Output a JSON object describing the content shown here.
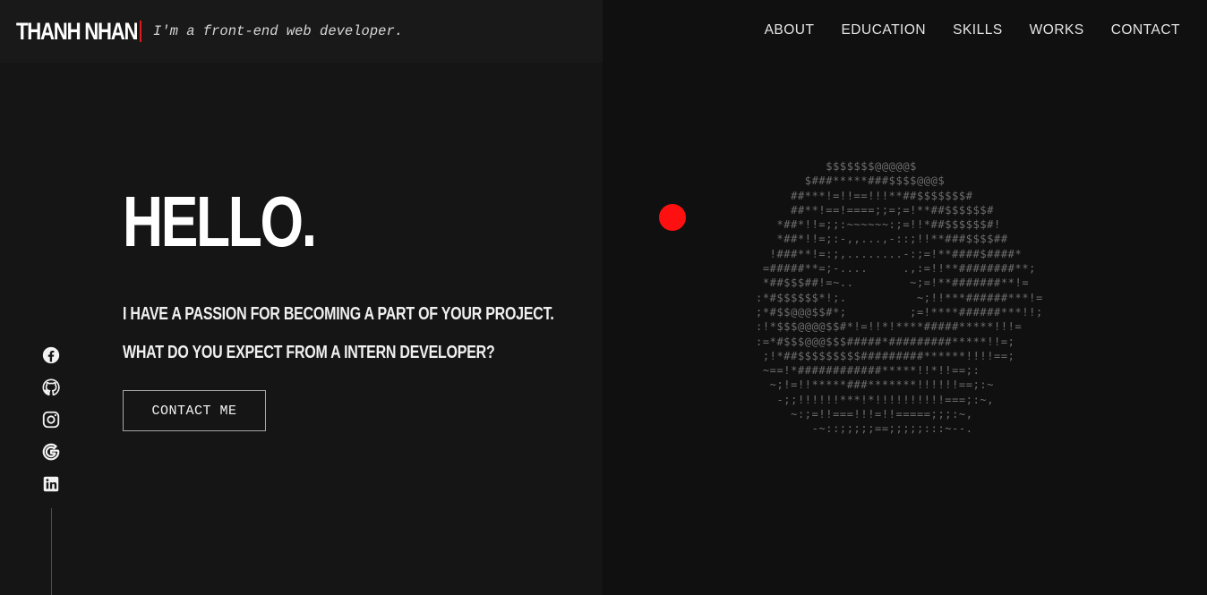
{
  "header": {
    "logo": "THANH NHAN",
    "tagline": "I'm a front-end web developer.",
    "nav": [
      "ABOUT",
      "EDUCATION",
      "SKILLS",
      "WORKS",
      "CONTACT"
    ]
  },
  "hero": {
    "title": "HELLO.",
    "line1": "I HAVE A PASSION FOR BECOMING A PART OF YOUR PROJECT.",
    "line2": "WHAT DO YOU EXPECT FROM A INTERN DEVELOPER?",
    "cta": "CONTACT ME"
  },
  "socials": [
    "facebook-icon",
    "github-icon",
    "instagram-icon",
    "google-icon",
    "linkedin-icon"
  ],
  "colors": {
    "accent": "#e01a1a",
    "cursor_dot": "#ff1010",
    "background_left": "#151515",
    "background_right": "#101010"
  },
  "ascii_art": [
    "          $$$$$$$@@@@@$",
    "       $###*****###$$$$@@@$",
    "     ##***!=!!==!!!**##$$$$$$$#",
    "     ##**!==!====;;=;=!**##$$$$$$#",
    "   *##*!!=;;:~~~~~~:;=!!*##$$$$$$#!",
    "   *##*!!=;:-,,...,-::;!!**###$$$$##",
    "  !###**!=:;,........-:;=!**####$####*",
    " =#####**=;-....     .,:=!!**########**;",
    " *##$$$##!=~..        ~;=!**#######**!=",
    ":*#$$$$$$*!;.          ~;!!***######***!=",
    ";*#$$@@@$$#*;         ;=!****######***!!;",
    ":!*$$$@@@@$$#*!=!!*!****#####*****!!!=",
    ":=*#$$$@@@$$$#####*#########*****!!=;",
    " ;!*##$$$$$$$$$#########******!!!!==;",
    " ~==!*############*****!!*!!==;:",
    "  ~;!=!!*****###*******!!!!!!==;:~",
    "   -;;!!!!!!***!*!!!!!!!!!!===;:~,",
    "     ~:;=!!===!!!=!!=====;;;:~,",
    "        -~::;;;;;==;;;;;:::~--."
  ]
}
